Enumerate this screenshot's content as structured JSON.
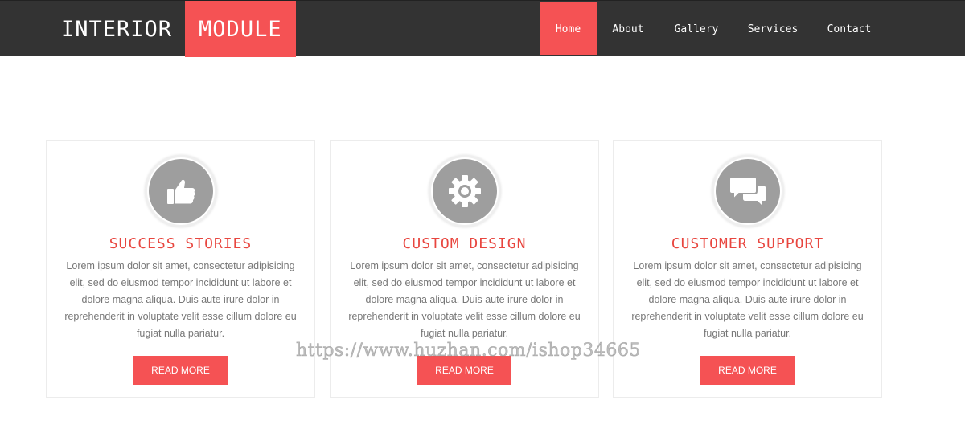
{
  "header": {
    "logo_part1": "INTERIOR",
    "logo_part2": "MODULE",
    "nav": [
      {
        "label": "Home",
        "active": true
      },
      {
        "label": "About",
        "active": false
      },
      {
        "label": "Gallery",
        "active": false
      },
      {
        "label": "Services",
        "active": false
      },
      {
        "label": "Contact",
        "active": false
      }
    ]
  },
  "cards": [
    {
      "icon": "thumbs-up-icon",
      "title": "SUCCESS STORIES",
      "text": "Lorem ipsum dolor sit amet, consectetur adipisicing elit, sed do eiusmod tempor incididunt ut labore et dolore magna aliqua. Duis aute irure dolor in reprehenderit in voluptate velit esse cillum dolore eu fugiat nulla pariatur.",
      "button": "READ MORE"
    },
    {
      "icon": "gear-icon",
      "title": "CUSTOM DESIGN",
      "text": "Lorem ipsum dolor sit amet, consectetur adipisicing elit, sed do eiusmod tempor incididunt ut labore et dolore magna aliqua. Duis aute irure dolor in reprehenderit in voluptate velit esse cillum dolore eu fugiat nulla pariatur.",
      "button": "READ MORE"
    },
    {
      "icon": "chat-bubbles-icon",
      "title": "CUSTOMER SUPPORT",
      "text": "Lorem ipsum dolor sit amet, consectetur adipisicing elit, sed do eiusmod tempor incididunt ut labore et dolore magna aliqua. Duis aute irure dolor in reprehenderit in voluptate velit esse cillum dolore eu fugiat nulla pariatur.",
      "button": "READ MORE"
    }
  ],
  "watermark": "https://www.huzhan.com/ishop34665",
  "colors": {
    "accent": "#f55254",
    "header_bg": "#333333",
    "title": "#e8463f",
    "icon_bg": "#9e9e9e"
  }
}
